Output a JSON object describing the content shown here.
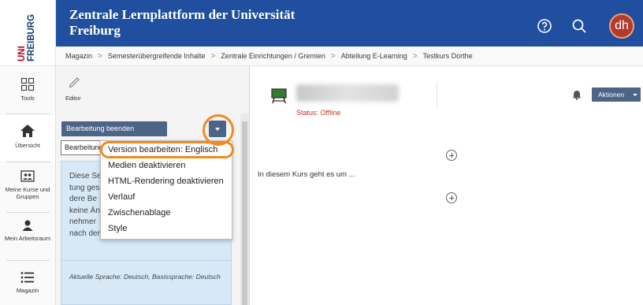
{
  "logo": {
    "line1": "UNI",
    "line2": "FREIBURG"
  },
  "header": {
    "title": "Zentrale Lernplattform der Universität Freiburg",
    "avatar_initials": "dh"
  },
  "breadcrumb": [
    "Magazin",
    "Semesterübergreifende Inhalte",
    "Zentrale Einrichtungen / Gremien",
    "Abteilung E-Learning",
    "Testkurs Dorthe"
  ],
  "mainbar": {
    "items": [
      {
        "label": "Tools",
        "icon": "tools-grid-icon"
      },
      {
        "label": "Übersicht",
        "icon": "home-icon"
      },
      {
        "label": "Meine Kurse und Gruppen",
        "icon": "courses-icon"
      },
      {
        "label": "Mein Arbeitsraum",
        "icon": "person-icon"
      },
      {
        "label": "Magazin",
        "icon": "list-icon"
      }
    ]
  },
  "slate": {
    "editor_label": "Editor",
    "end_button": "Bearbeitung beenden",
    "select_value": "Bearbeitung",
    "info_text": "Diese Seite ist während der Bearbeitung gesperrt. Solange keine anderen Teilnehmer Änderungen vornehmen, wird sie nach der Bearbeitung wieder frei.",
    "info_lines": [
      "Diese Se",
      "tung ges",
      "dere Be",
      "keine Än",
      "nehmer",
      "nach der Bearbeitung wieder frei."
    ],
    "language_text": "Aktuelle Sprache: Deutsch, Basissprache: Deutsch"
  },
  "menu": {
    "items": [
      "Version bearbeiten: Englisch",
      "Medien deaktivieren",
      "HTML-Rendering deaktivieren",
      "Verlauf",
      "Zwischenablage",
      "Style"
    ]
  },
  "content": {
    "status": "Status: Offline",
    "actions_button": "Aktionen",
    "text": "In diesem Kurs geht es um ..."
  },
  "colors": {
    "header": "#1f4f9e",
    "button": "#4c6586",
    "highlight": "#f28a1c",
    "info_bg": "#d7e9f7",
    "status": "#c0392b"
  }
}
